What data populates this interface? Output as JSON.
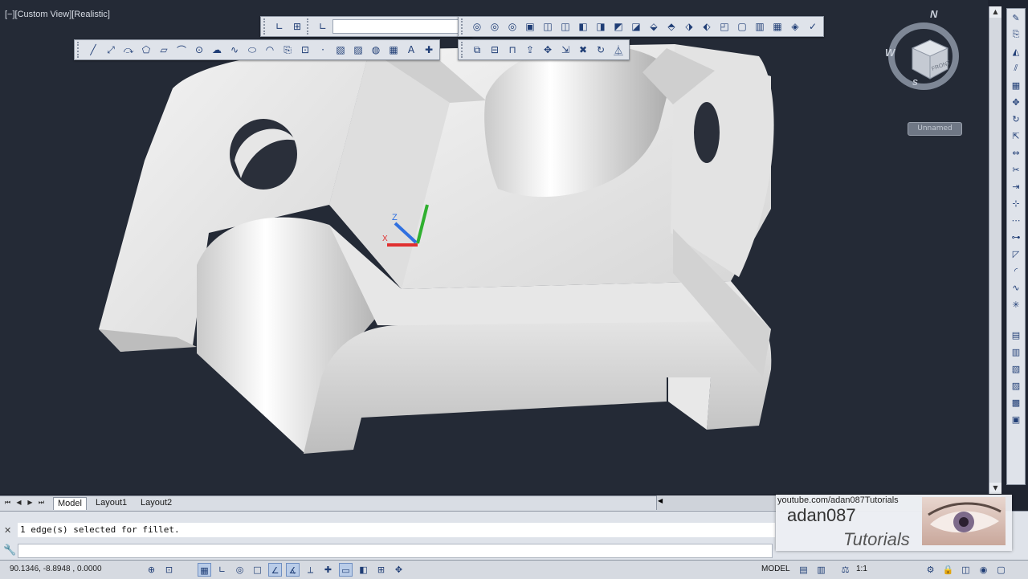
{
  "viewport": {
    "view_label": "[−][Custom View][Realistic]"
  },
  "toolbars": {
    "ucs_dropdown_value": "",
    "draw_tools": [
      "line-icon",
      "construction-line-icon",
      "polyline-icon",
      "polygon-icon",
      "rectangle-icon",
      "arc-icon",
      "circle-icon",
      "revision-cloud-icon",
      "spline-icon",
      "ellipse-icon",
      "ellipse-arc-icon",
      "insert-block-icon",
      "make-block-icon",
      "point-icon",
      "hatch-icon",
      "gradient-icon",
      "region-icon",
      "table-icon",
      "multiline-text-icon",
      "add-selected-icon"
    ],
    "view_tools": [
      "orbit-icon",
      "free-orbit-icon",
      "continuous-orbit-icon",
      "named-views-icon",
      "top-view-icon",
      "bottom-view-icon",
      "left-view-icon",
      "right-view-icon",
      "front-view-icon",
      "back-view-icon",
      "sw-iso-icon",
      "se-iso-icon",
      "ne-iso-icon",
      "nw-iso-icon",
      "camera-icon",
      "2d-wireframe-icon",
      "3d-hidden-icon",
      "realistic-icon",
      "conceptual-icon"
    ],
    "solid_edit_tools": [
      "union-icon",
      "subtract-icon",
      "intersect-icon",
      "extrude-faces-icon",
      "move-faces-icon",
      "offset-faces-icon",
      "delete-faces-icon",
      "rotate-faces-icon",
      "taper-faces-icon"
    ]
  },
  "viewcube": {
    "north": "N",
    "west": "W",
    "south": "S",
    "cube_face": "FRONT",
    "ucs_menu": "Unnamed"
  },
  "tabs": {
    "items": [
      {
        "label": "Model",
        "active": true
      },
      {
        "label": "Layout1",
        "active": false
      },
      {
        "label": "Layout2",
        "active": false
      }
    ]
  },
  "command": {
    "history": "1 edge(s) selected for fillet.",
    "prompt": ""
  },
  "status": {
    "coordinates": "90.1346, -8.8948 , 0.0000",
    "model_label": "MODEL",
    "scale": "1:1"
  },
  "watermark": {
    "url": "youtube.com/adan087Tutorials",
    "name": "adan087",
    "sub": "Tutorials"
  },
  "colors": {
    "viewport_bg": "#242a36",
    "model_light": "#f2f2f2",
    "model_mid": "#d5d5d5",
    "model_dark": "#a8a8a8",
    "ucs_x": "#e03030",
    "ucs_y": "#30b030",
    "ucs_z": "#3070e0"
  }
}
